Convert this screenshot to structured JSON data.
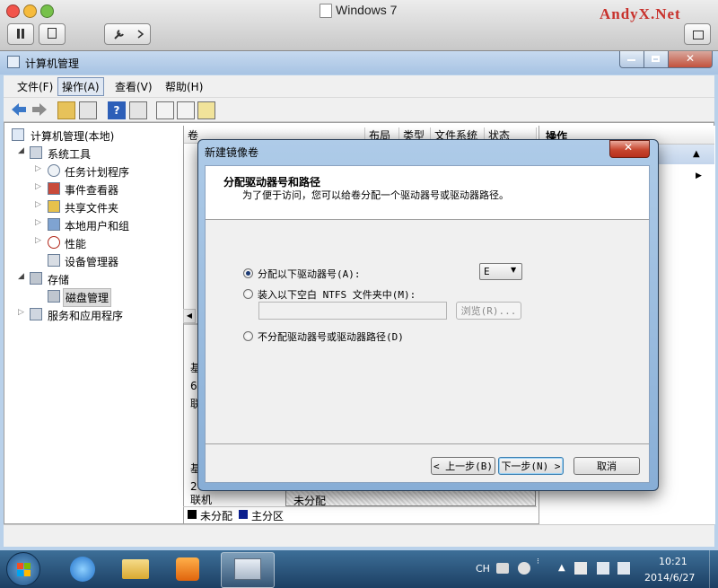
{
  "host": {
    "title": "Windows 7",
    "watermark": "AndyX.Net"
  },
  "window": {
    "title": "计算机管理"
  },
  "menu": [
    "文件(F)",
    "操作(A)",
    "查看(V)",
    "帮助(H)"
  ],
  "tree": {
    "root": "计算机管理(本地)",
    "system_tools": "系统工具",
    "task_scheduler": "任务计划程序",
    "event_viewer": "事件查看器",
    "shared_folders": "共享文件夹",
    "local_users": "本地用户和组",
    "performance": "性能",
    "device_manager": "设备管理器",
    "storage": "存储",
    "disk_management": "磁盘管理",
    "services": "服务和应用程序"
  },
  "columns": [
    "卷",
    "布局",
    "类型",
    "文件系统",
    "状态"
  ],
  "actions_header": "操作",
  "mid": {
    "disk_letters_1": [
      "基",
      "6",
      "联"
    ],
    "disk_letters_2": [
      "基",
      "2",
      "联"
    ],
    "online": "联机",
    "unallocated": "未分配",
    "legend_unallocated": "未分配",
    "legend_primary": "主分区"
  },
  "dialog": {
    "title": "新建镜像卷",
    "heading": "分配驱动器号和路径",
    "subheading": "为了便于访问，您可以给卷分配一个驱动器号或驱动器路径。",
    "option1": "分配以下驱动器号(A):",
    "option2": "装入以下空白 NTFS 文件夹中(M):",
    "option3": "不分配驱动器号或驱动器路径(D)",
    "drive_letter": "E",
    "browse": "浏览(R)...",
    "back": "< 上一步(B)",
    "next": "下一步(N) >",
    "cancel": "取消"
  },
  "taskbar": {
    "lang": "CH",
    "time": "10:21",
    "date": "2014/6/27"
  },
  "colors": {
    "taskbar": "#1c3f63",
    "dialog_frame": "#88aed6",
    "close": "#c7462f"
  }
}
